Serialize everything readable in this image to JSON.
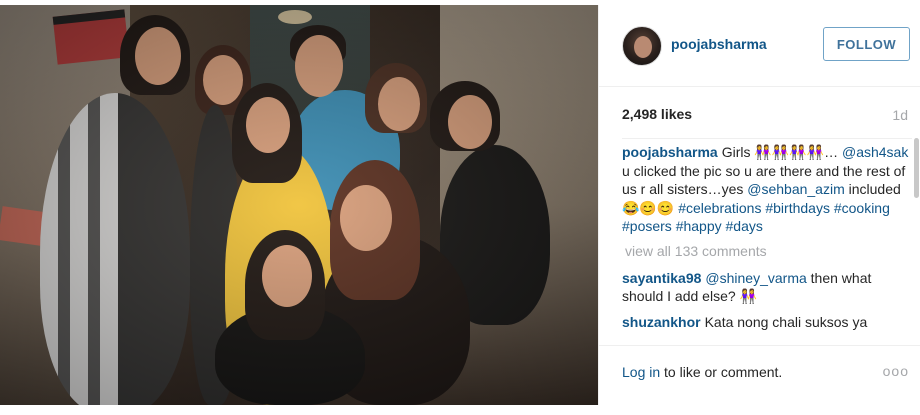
{
  "post": {
    "username": "poojabsharma",
    "follow_label": "FOLLOW",
    "likes": "2,498 likes",
    "time": "1d"
  },
  "caption": {
    "user": "poojabsharma",
    "part1": "Girls 👭👭👭👭…",
    "tag1": "@ash4sak",
    "part2": " u clicked the pic so u are there and the rest of us r all sisters…yes ",
    "tag2": "@sehban_azim",
    "part3": " included 😂😊😊 ",
    "hashtags": "#celebrations #birthdays #cooking #posers #happy #days"
  },
  "view_all": "view all 133 comments",
  "comments": [
    {
      "user": "sayantika98",
      "tag": "@shiney_varma",
      "text": " then what should I add else? 👭"
    },
    {
      "user": "shuzankhor",
      "tag": "",
      "text": "Kata nong chali suksos ya"
    }
  ],
  "footer": {
    "login_link": "Log in",
    "login_rest": " to like or comment.",
    "more": "ooo"
  },
  "icons": {
    "more": "more-options-icon"
  }
}
